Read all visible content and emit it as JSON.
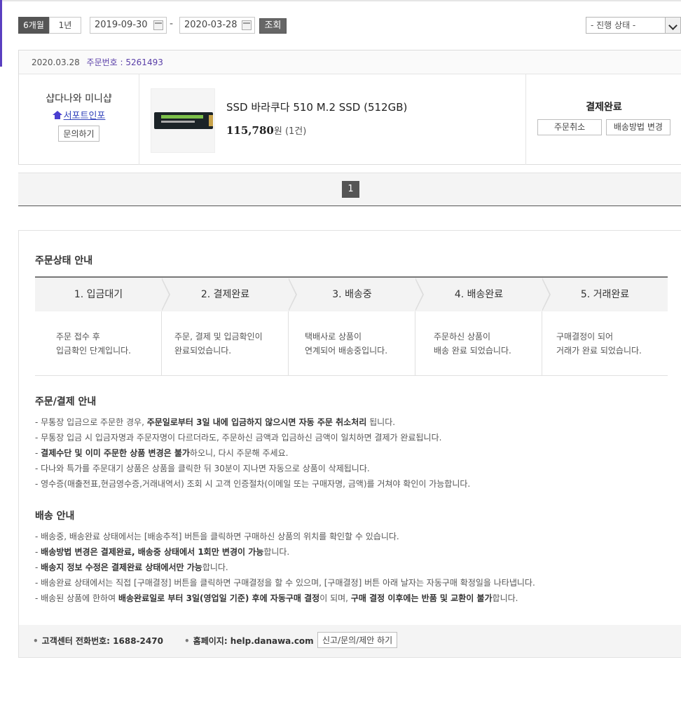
{
  "filter": {
    "period_6m": "6개월",
    "period_1y": "1년",
    "date_from": "2019-09-30",
    "date_to": "2020-03-28",
    "dash": "-",
    "search_label": "조회",
    "status_select": "- 진행 상태 -"
  },
  "order": {
    "date": "2020.03.28",
    "order_no_label": "주문번호 :",
    "order_no": "5261493",
    "shop_name": "샵다나와 미니샵",
    "shop_link": "서포트인포",
    "ask_label": "문의하기",
    "product_name": "SSD 바라쿠다 510 M.2 SSD (512GB)",
    "price": "115,780",
    "price_unit": "원",
    "qty": "(1건)",
    "status": "결제완료",
    "cancel_label": "주문취소",
    "ship_change_label": "배송방법 변경"
  },
  "pagination": {
    "current": "1"
  },
  "guide": {
    "title": "주문상태 안내",
    "steps": [
      {
        "title": "1. 입금대기",
        "line1": "주문 접수 후",
        "line2": "입금확인 단계입니다."
      },
      {
        "title": "2. 결제완료",
        "line1": "주문, 결제 및 입금확인이",
        "line2": "완료되었습니다."
      },
      {
        "title": "3. 배송중",
        "line1": "택배사로 상품이",
        "line2": "연계되어 배송중입니다."
      },
      {
        "title": "4. 배송완료",
        "line1": "주문하신 상품이",
        "line2": "배송 완료 되었습니다."
      },
      {
        "title": "5. 거래완료",
        "line1": "구매결정이 되어",
        "line2": "거래가 완료 되었습니다."
      }
    ],
    "payment_title": "주문/결제 안내",
    "payment": {
      "l1a": "- 무통장 입금으로 주문한 경우, ",
      "l1b": "주문일로부터 3일 내에 입금하지 않으시면 자동 주문 취소처리",
      "l1c": " 됩니다.",
      "l2": "- 무통장 입금 시 입금자명과 주문자명이 다르더라도, 주문하신 금액과 입금하신 금액이 일치하면 결제가 완료됩니다.",
      "l3a": "- ",
      "l3b": "결제수단 및 이미 주문한 상품 변경은 불가",
      "l3c": "하오니, 다시 주문해 주세요.",
      "l4": "- 다나와 특가를 주문대기 상품은 상품을 클릭한 뒤 30분이 지나면 자동으로 상품이 삭제됩니다.",
      "l5": "- 영수증(매출전표,현금영수증,거래내역서) 조회 시 고객 인증절차(이메일 또는 구매자명, 금액)를 거쳐야 확인이 가능합니다."
    },
    "delivery_title": "배송 안내",
    "delivery": {
      "l1": "- 배송중, 배송완료 상태에서는 [배송추적] 버튼을 클릭하면 구매하신 상품의 위치를 확인할 수 있습니다.",
      "l2a": "- ",
      "l2b": "배송방법 변경은 결제완료, 배송중 상태에서 1회만 변경이 가능",
      "l2c": "합니다.",
      "l3a": "- ",
      "l3b": "배송지 정보 수정은 결제완료 상태에서만 가능",
      "l3c": "합니다.",
      "l4": "- 배송완료 상태에서는 직접 [구매결정] 버튼을 클릭하면 구매결정을 할 수 있으며, [구매결정] 버튼 아래 날자는 자동구매 확정일을 나타냅니다.",
      "l5a": "- 배송된 상품에 한하여 ",
      "l5b": "배송완료일로 부터 3일(영업일 기준) 후에 자동구매 결정",
      "l5c": "이 되며, ",
      "l5d": "구매 결정 이후에는 반품 및 교환이 불가",
      "l5e": "합니다."
    }
  },
  "footer": {
    "phone": "고객센터 전화번호: 1688-2470",
    "homepage": "홈페이지: help.danawa.com",
    "report_label": "신고/문의/제안 하기"
  }
}
